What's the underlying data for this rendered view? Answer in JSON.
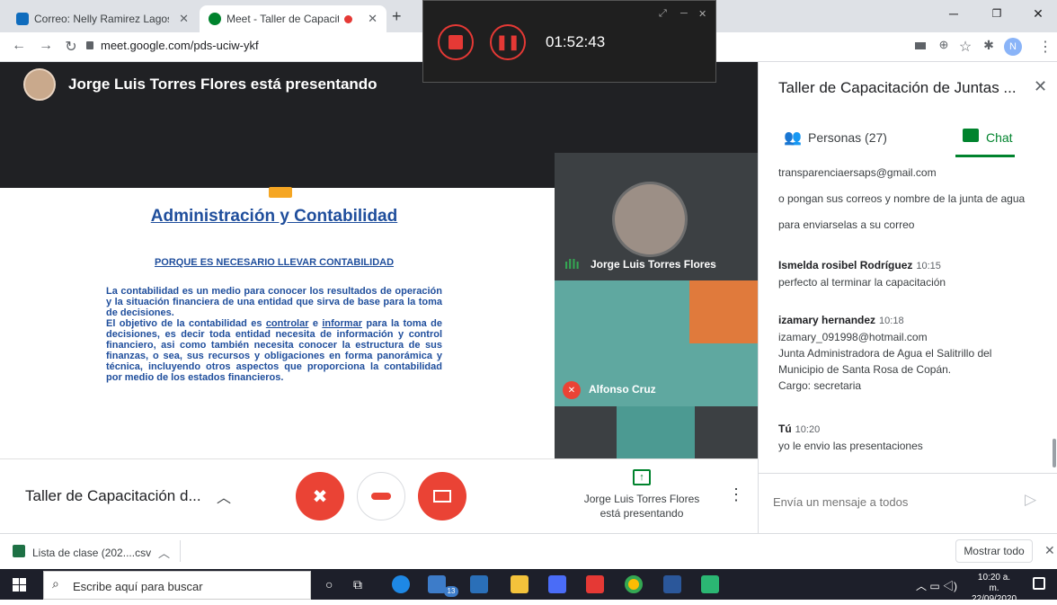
{
  "browser": {
    "tabs": [
      {
        "label": "Correo: Nelly Ramirez Lagos - Ou",
        "active": false
      },
      {
        "label": "Meet - Taller de Capacitación",
        "active": true
      }
    ],
    "new_tab": "+",
    "url": "meet.google.com/pds-uciw-ykf",
    "profile_initial": "N"
  },
  "recorder": {
    "timer": "01:52:43"
  },
  "meeting": {
    "presenter_banner": "Jorge Luis Torres Flores está presentando",
    "title": "Taller de Capacitación d...",
    "presenting_label": "Jorge Luis Torres Flores está presentando"
  },
  "slide": {
    "title": "Administración y Contabilidad",
    "subtitle": "PORQUE ES NECESARIO LLEVAR CONTABILIDAD",
    "para1": "La contabilidad es un medio para conocer los resultados de operación y la situación financiera de una entidad que sirva de base para la toma de decisiones.",
    "para2_a": "El objetivo de la contabilidad es ",
    "para2_b": "controlar",
    "para2_c": " e ",
    "para2_d": "informar",
    "para2_e": " para la toma de decisiones, es decir toda entidad necesita de información y control financiero, asi como también necesita conocer la estructura de sus finanzas, o sea, sus recursos y obligaciones en forma panorámica y técnica, incluyendo otros aspectos que proporciona la contabilidad por medio de los estados financieros."
  },
  "tiles": [
    {
      "name": "Jorge Luis Torres Flores"
    },
    {
      "name": "Alfonso Cruz"
    }
  ],
  "panel": {
    "title": "Taller de Capacitación de Juntas ...",
    "tab_people": "Personas (27)",
    "tab_chat": "Chat",
    "messages": [
      {
        "sender": "",
        "time": "",
        "lines": [
          "transparenciaersaps@gmail.com"
        ]
      },
      {
        "sender": "",
        "time": "",
        "lines": [
          "o pongan sus correos y nombre de la junta de agua"
        ]
      },
      {
        "sender": "",
        "time": "",
        "lines": [
          "para enviarselas a su correo"
        ]
      },
      {
        "sender": "Ismelda rosibel Rodríguez",
        "time": "10:15",
        "lines": [
          "perfecto al terminar la capacitación"
        ]
      },
      {
        "sender": "izamary hernandez",
        "time": "10:18",
        "lines": [
          "izamary_091998@hotmail.com",
          "Junta Administradora de Agua el Salitrillo  del",
          "Municipio de Santa Rosa de Copán.",
          "Cargo: secretaria"
        ]
      },
      {
        "sender": "Tú",
        "time": "10:20",
        "lines": [
          "yo le envio las presentaciones"
        ]
      }
    ],
    "input_placeholder": "Envía un mensaje a todos"
  },
  "download": {
    "file": "Lista de clase (202....csv",
    "show_all": "Mostrar todo"
  },
  "taskbar": {
    "search": "Escribe aquí para buscar",
    "time": "10:20 a. m.",
    "date": "22/09/2020",
    "badge": "13"
  },
  "colors": {
    "accent_red": "#ea4335",
    "meet_green": "#00832d",
    "slide_blue": "#1f4e9c"
  }
}
